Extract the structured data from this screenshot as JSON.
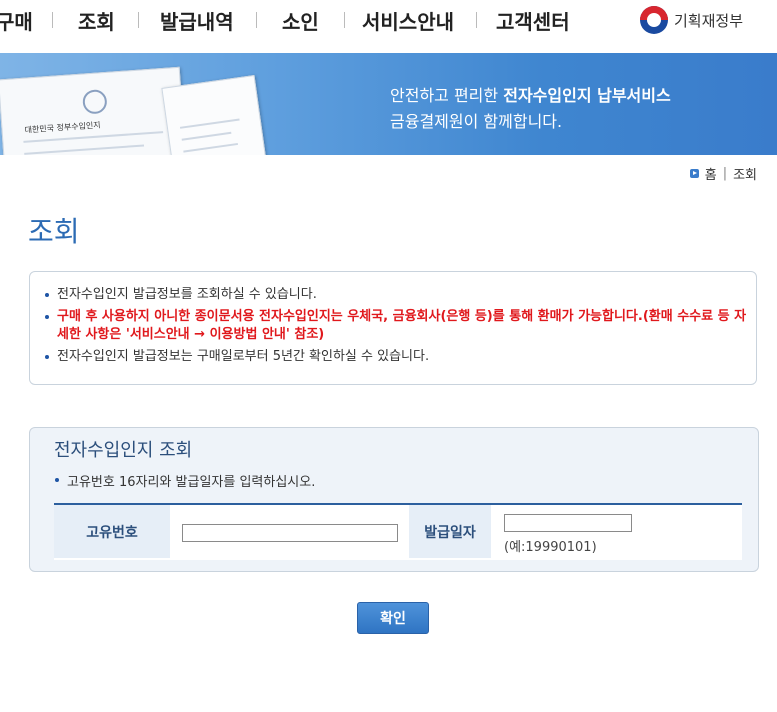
{
  "nav": {
    "items": [
      "구매",
      "조회",
      "발급내역",
      "소인",
      "서비스안내",
      "고객센터"
    ],
    "logo_text": "기획재정부"
  },
  "banner": {
    "line1_prefix": "안전하고 편리한 ",
    "line1_bold": "전자수입인지 납부서비스",
    "line2": "금융결제원이 함께합니다.",
    "doc_title": "대한민국 정부수입인지"
  },
  "breadcrumb": {
    "home": "홈",
    "current": "조회"
  },
  "page_title": "조회",
  "notice": {
    "items": [
      "전자수입인지 발급정보를 조회하실 수 있습니다.",
      "구매 후 사용하지 아니한 종이문서용 전자수입인지는 우체국, 금융회사(은행 등)를 통해 환매가 가능합니다.(환매 수수료 등 자세한 사항은 '서비스안내 → 이용방법 안내' 참조)",
      "전자수입인지 발급정보는 구매일로부터 5년간 확인하실 수 있습니다."
    ]
  },
  "search": {
    "title": "전자수입인지 조회",
    "desc": "고유번호 16자리와 발급일자를 입력하십시오.",
    "id_label": "고유번호",
    "id_value": "",
    "date_label": "발급일자",
    "date_value": "",
    "date_hint": "(예:19990101)"
  },
  "confirm_label": "확인",
  "colors": {
    "primary": "#2c6bb4",
    "warning": "#e0181c",
    "banner": "#3f86d0"
  }
}
